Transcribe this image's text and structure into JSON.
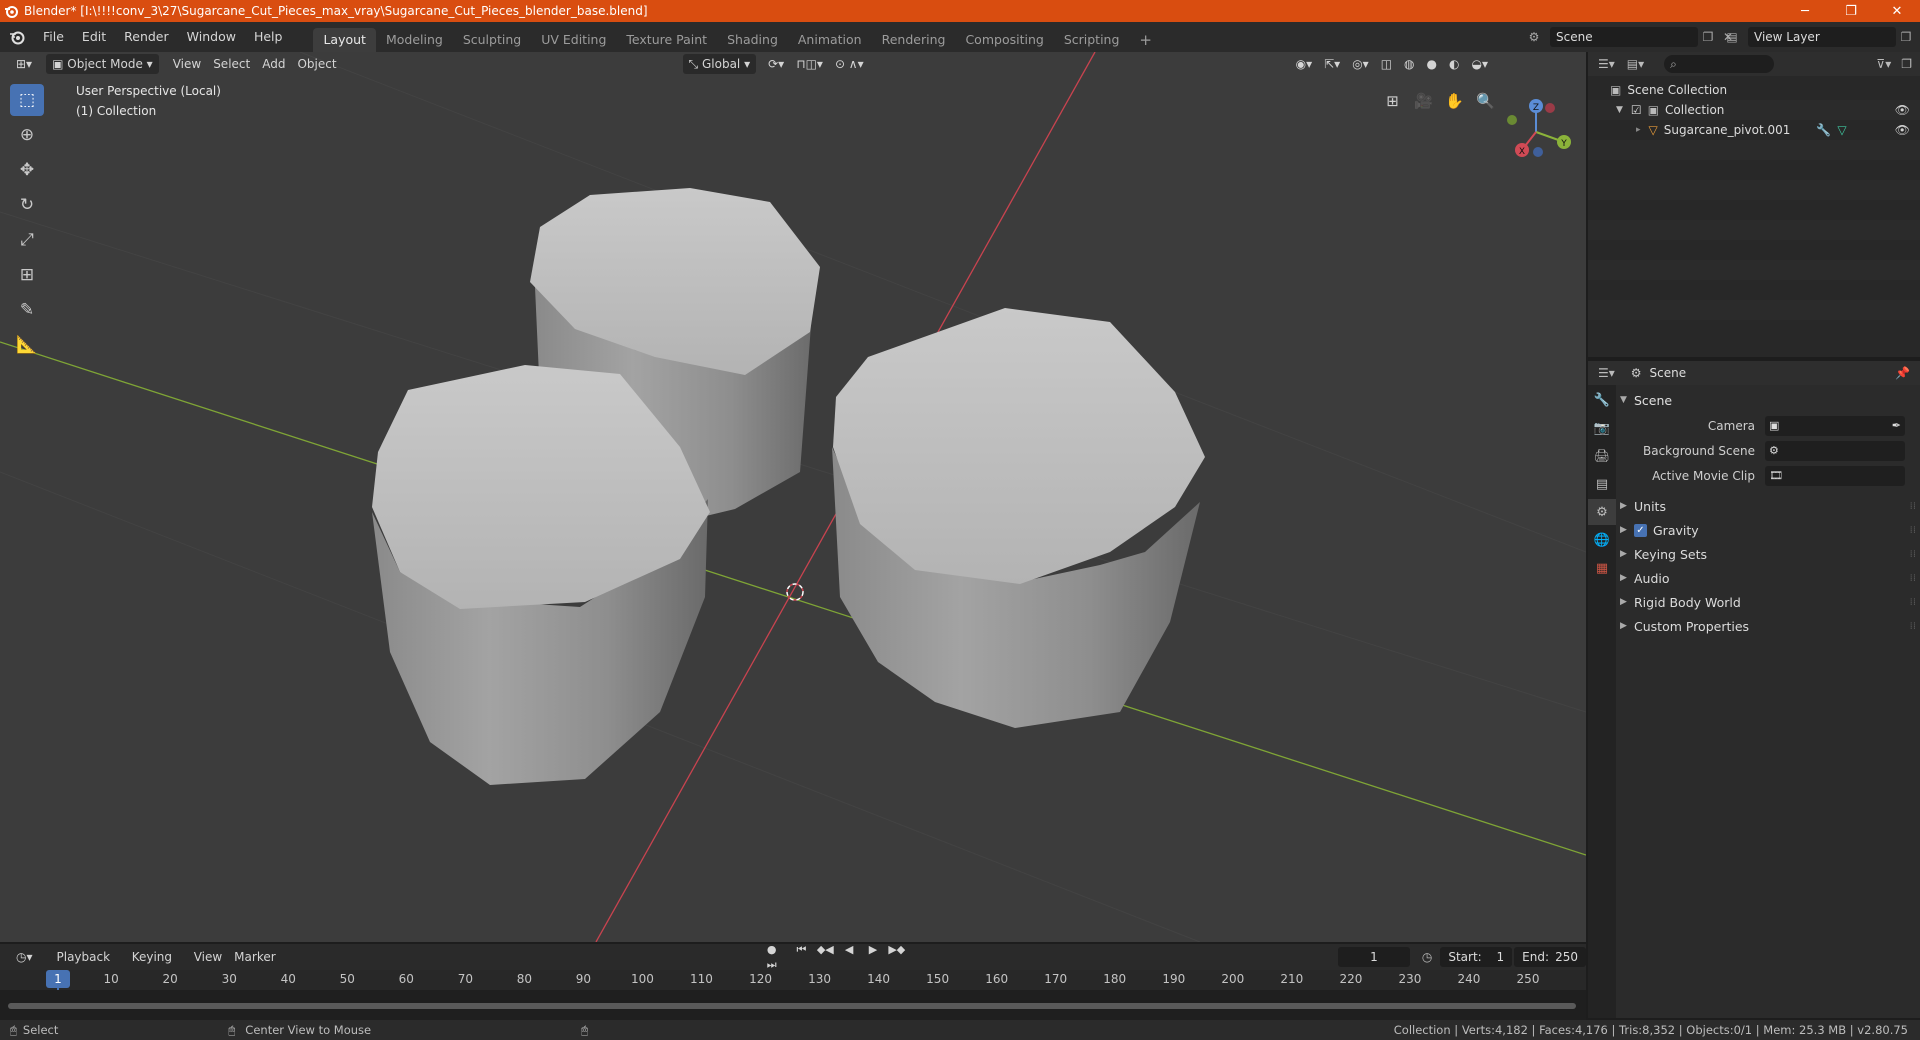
{
  "window": {
    "title": "Blender* [I:\\!!!!conv_3\\27\\Sugarcane_Cut_Pieces_max_vray\\Sugarcane_Cut_Pieces_blender_base.blend]",
    "minimize": "─",
    "maximize": "❐",
    "close": "✕"
  },
  "menus": [
    "File",
    "Edit",
    "Render",
    "Window",
    "Help"
  ],
  "workspaces": [
    "Layout",
    "Modeling",
    "Sculpting",
    "UV Editing",
    "Texture Paint",
    "Shading",
    "Animation",
    "Rendering",
    "Compositing",
    "Scripting",
    "+"
  ],
  "scene_selector": {
    "value": "Scene"
  },
  "view_layer_selector": {
    "value": "View Layer"
  },
  "viewport": {
    "mode": "Object Mode",
    "menus": [
      "View",
      "Select",
      "Add",
      "Object"
    ],
    "orientation": "Global",
    "overlay_line1": "User Perspective (Local)",
    "overlay_line2": "(1) Collection",
    "gizmo_axes": [
      "X",
      "Y",
      "Z"
    ]
  },
  "outliner": {
    "rows": [
      "Scene Collection",
      "Collection",
      "Sugarcane_pivot.001"
    ]
  },
  "properties": {
    "header_title": "Scene",
    "panel_title": "Scene",
    "fields": [
      {
        "label": "Camera",
        "value": ""
      },
      {
        "label": "Background Scene",
        "value": ""
      },
      {
        "label": "Active Movie Clip",
        "value": ""
      }
    ],
    "subpanels": [
      "Units",
      "Gravity",
      "Keying Sets",
      "Audio",
      "Rigid Body World",
      "Custom Properties"
    ],
    "gravity_checked": true
  },
  "timeline": {
    "menus": [
      "Playback",
      "Keying",
      "View",
      "Marker"
    ],
    "current_frame": "1",
    "start_label": "Start:",
    "start": "1",
    "end_label": "End:",
    "end": "250",
    "ruler_ticks": [
      "1",
      "10",
      "20",
      "30",
      "40",
      "50",
      "60",
      "70",
      "80",
      "90",
      "100",
      "110",
      "120",
      "130",
      "140",
      "150",
      "160",
      "170",
      "180",
      "190",
      "200",
      "210",
      "220",
      "230",
      "240",
      "250"
    ]
  },
  "statusbar": {
    "left_action": "Select",
    "middle_action": "Center View to Mouse",
    "stats": "Collection | Verts:4,182 | Faces:4,176 | Tris:8,352 | Objects:0/1 | Mem: 25.3 MB | v2.80.75"
  },
  "colors": {
    "titlebar": "#d94d10",
    "accent": "#4772b3",
    "x_axis": "#c8434f",
    "y_axis": "#7fa536"
  }
}
